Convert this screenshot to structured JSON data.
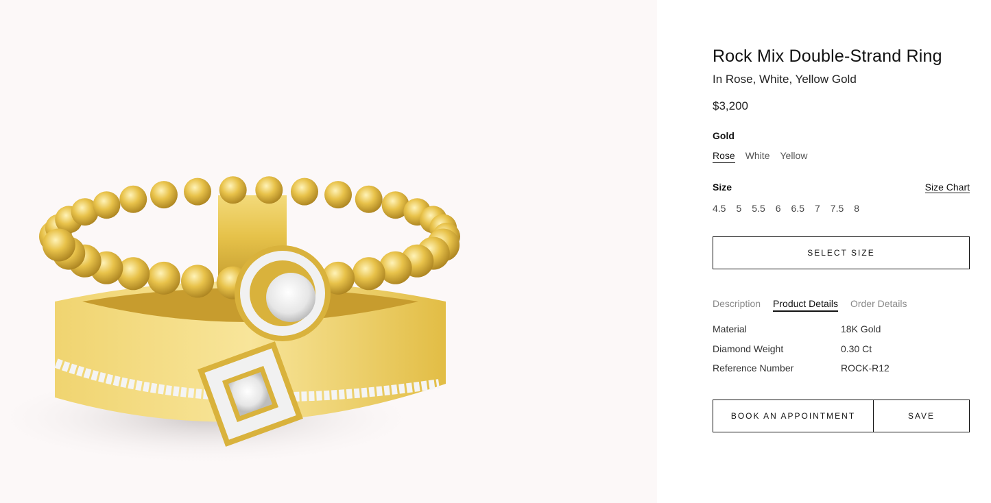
{
  "product": {
    "title": "Rock Mix Double-Strand Ring",
    "subtitle": "In Rose, White, Yellow Gold",
    "price": "$3,200"
  },
  "gold": {
    "label": "Gold",
    "options": [
      "Rose",
      "White",
      "Yellow"
    ],
    "selected": "Rose"
  },
  "size": {
    "label": "Size",
    "chart_link": "Size Chart",
    "options": [
      "4.5",
      "5",
      "5.5",
      "6",
      "6.5",
      "7",
      "7.5",
      "8"
    ],
    "select_button": "SELECT SIZE"
  },
  "tabs": {
    "items": [
      "Description",
      "Product Details",
      "Order Details"
    ],
    "active": "Product Details"
  },
  "details": [
    {
      "key": "Material",
      "value": "18K Gold"
    },
    {
      "key": "Diamond Weight",
      "value": "0.30 Ct"
    },
    {
      "key": "Reference Number",
      "value": "ROCK-R12"
    }
  ],
  "actions": {
    "book": "BOOK AN APPOINTMENT",
    "save": "SAVE"
  },
  "colors": {
    "gallery_bg": "#fcf8f8",
    "gold": "#e8c64a",
    "gold_dark": "#b8922a",
    "diamond": "#f2f2f2"
  }
}
